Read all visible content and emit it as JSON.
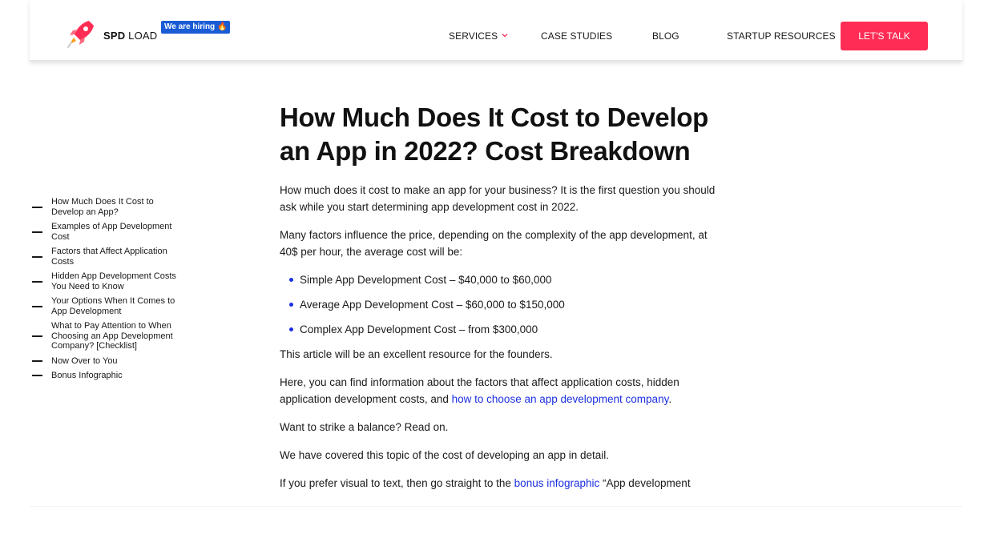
{
  "header": {
    "logo_bold": "SPD",
    "logo_light": "LOAD",
    "hiring_badge": "We are hiring 🔥",
    "nav": {
      "services": "SERVICES",
      "case_studies": "CASE STUDIES",
      "blog": "BLOG",
      "startup_resources": "STARTUP RESOURCES"
    },
    "cta": "LET'S TALK",
    "accent_color": "#ff2d55",
    "badge_color": "#1a5cd6"
  },
  "toc": {
    "items": [
      "How Much Does It Cost to Develop an App?",
      "Examples of App Development Cost",
      "Factors that Affect Application Costs",
      "Hidden App Development Costs You Need to Know",
      "Your Options When It Comes to App Development",
      "What to Pay Attention to When Choosing an App Development Company? [Checklist]",
      "Now Over to You",
      "Bonus Infographic"
    ]
  },
  "article": {
    "title": "How Much Does It Cost to Develop an App in 2022? Cost Breakdown",
    "p1": "How much does it cost to make an app for your business? It is the first question you should ask while you start determining app development cost in 2022.",
    "p2": "Many factors influence the price, depending on the complexity of the app development, at 40$ per hour, the average cost will be:",
    "bullets": [
      "Simple App Development Cost – $40,000 to $60,000",
      "Average App Development Cost – $60,000 to $150,000",
      "Complex App Development Cost – from $300,000"
    ],
    "p3": "This article will be an excellent resource for the founders.",
    "p4_before": "Here, you can find information about the factors that affect application costs, hidden application development costs, and ",
    "p4_link": "how to choose an app development company",
    "p4_after": ".",
    "p5": "Want to strike a balance? Read on.",
    "p6": "We have covered this topic of the cost of developing an app in detail.",
    "p7_before": "If you prefer visual to text, then go straight to the ",
    "p7_link": "bonus infographic",
    "p7_after": " “App development",
    "link_color": "#1b2fe0"
  }
}
